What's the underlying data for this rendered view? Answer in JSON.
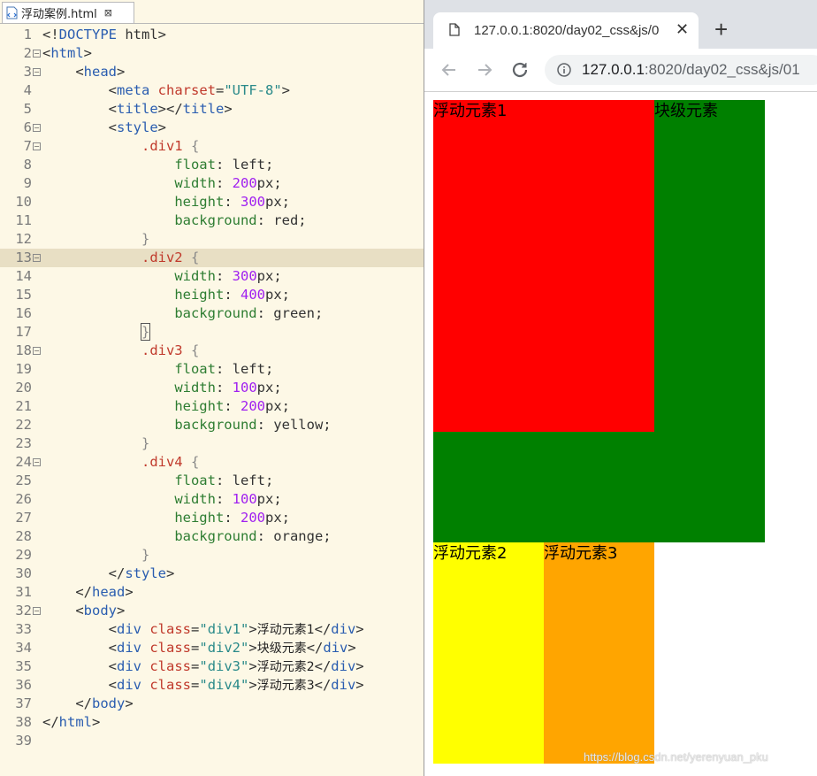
{
  "editor": {
    "tab_title": "浮动案例.html",
    "tab_close": "⊠",
    "highlighted_line": 13
  },
  "code_lines": [
    {
      "n": "1",
      "fold": false,
      "tokens": [
        [
          "t-punct",
          "<!"
        ],
        [
          "t-tag",
          "DOCTYPE"
        ],
        [
          "t-kw",
          " html"
        ],
        [
          "t-punct",
          ">"
        ]
      ]
    },
    {
      "n": "2",
      "fold": true,
      "tokens": [
        [
          "t-punct",
          "<"
        ],
        [
          "t-tag",
          "html"
        ],
        [
          "t-punct",
          ">"
        ]
      ]
    },
    {
      "n": "3",
      "fold": true,
      "tokens": [
        [
          "t-kw",
          "    "
        ],
        [
          "t-punct",
          "<"
        ],
        [
          "t-tag",
          "head"
        ],
        [
          "t-punct",
          ">"
        ]
      ]
    },
    {
      "n": "4",
      "fold": false,
      "tokens": [
        [
          "t-kw",
          "        "
        ],
        [
          "t-punct",
          "<"
        ],
        [
          "t-tag",
          "meta"
        ],
        [
          "t-kw",
          " "
        ],
        [
          "t-attr",
          "charset"
        ],
        [
          "t-punct",
          "="
        ],
        [
          "t-val",
          "\"UTF-8\""
        ],
        [
          "t-punct",
          ">"
        ]
      ]
    },
    {
      "n": "5",
      "fold": false,
      "tokens": [
        [
          "t-kw",
          "        "
        ],
        [
          "t-punct",
          "<"
        ],
        [
          "t-tag",
          "title"
        ],
        [
          "t-punct",
          "></"
        ],
        [
          "t-tag",
          "title"
        ],
        [
          "t-punct",
          ">"
        ]
      ]
    },
    {
      "n": "6",
      "fold": true,
      "tokens": [
        [
          "t-kw",
          "        "
        ],
        [
          "t-punct",
          "<"
        ],
        [
          "t-tag",
          "style"
        ],
        [
          "t-punct",
          ">"
        ]
      ]
    },
    {
      "n": "7",
      "fold": true,
      "tokens": [
        [
          "t-kw",
          "            "
        ],
        [
          "t-sel",
          ".div1"
        ],
        [
          "t-kw",
          " "
        ],
        [
          "t-brace",
          "{"
        ]
      ]
    },
    {
      "n": "8",
      "fold": false,
      "tokens": [
        [
          "t-kw",
          "                "
        ],
        [
          "t-prop",
          "float"
        ],
        [
          "t-kw",
          ": left;"
        ]
      ]
    },
    {
      "n": "9",
      "fold": false,
      "tokens": [
        [
          "t-kw",
          "                "
        ],
        [
          "t-prop",
          "width"
        ],
        [
          "t-kw",
          ": "
        ],
        [
          "t-num",
          "200"
        ],
        [
          "t-unit",
          "px;"
        ]
      ]
    },
    {
      "n": "10",
      "fold": false,
      "tokens": [
        [
          "t-kw",
          "                "
        ],
        [
          "t-prop",
          "height"
        ],
        [
          "t-kw",
          ": "
        ],
        [
          "t-num",
          "300"
        ],
        [
          "t-unit",
          "px;"
        ]
      ]
    },
    {
      "n": "11",
      "fold": false,
      "tokens": [
        [
          "t-kw",
          "                "
        ],
        [
          "t-prop",
          "background"
        ],
        [
          "t-kw",
          ": red;"
        ]
      ]
    },
    {
      "n": "12",
      "fold": false,
      "tokens": [
        [
          "t-kw",
          "            "
        ],
        [
          "t-brace",
          "}"
        ]
      ]
    },
    {
      "n": "13",
      "fold": true,
      "tokens": [
        [
          "t-kw",
          "            "
        ],
        [
          "t-sel",
          ".div2"
        ],
        [
          "t-kw",
          " "
        ],
        [
          "t-brace",
          "{"
        ]
      ]
    },
    {
      "n": "14",
      "fold": false,
      "tokens": [
        [
          "t-kw",
          "                "
        ],
        [
          "t-prop",
          "width"
        ],
        [
          "t-kw",
          ": "
        ],
        [
          "t-num",
          "300"
        ],
        [
          "t-unit",
          "px;"
        ]
      ]
    },
    {
      "n": "15",
      "fold": false,
      "tokens": [
        [
          "t-kw",
          "                "
        ],
        [
          "t-prop",
          "height"
        ],
        [
          "t-kw",
          ": "
        ],
        [
          "t-num",
          "400"
        ],
        [
          "t-unit",
          "px;"
        ]
      ]
    },
    {
      "n": "16",
      "fold": false,
      "tokens": [
        [
          "t-kw",
          "                "
        ],
        [
          "t-prop",
          "background"
        ],
        [
          "t-kw",
          ": green;"
        ]
      ]
    },
    {
      "n": "17",
      "fold": false,
      "tokens": [
        [
          "t-kw",
          "            "
        ],
        [
          "t-brace bracket-box",
          "}"
        ]
      ]
    },
    {
      "n": "18",
      "fold": true,
      "tokens": [
        [
          "t-kw",
          "            "
        ],
        [
          "t-sel",
          ".div3"
        ],
        [
          "t-kw",
          " "
        ],
        [
          "t-brace",
          "{"
        ]
      ]
    },
    {
      "n": "19",
      "fold": false,
      "tokens": [
        [
          "t-kw",
          "                "
        ],
        [
          "t-prop",
          "float"
        ],
        [
          "t-kw",
          ": left;"
        ]
      ]
    },
    {
      "n": "20",
      "fold": false,
      "tokens": [
        [
          "t-kw",
          "                "
        ],
        [
          "t-prop",
          "width"
        ],
        [
          "t-kw",
          ": "
        ],
        [
          "t-num",
          "100"
        ],
        [
          "t-unit",
          "px;"
        ]
      ]
    },
    {
      "n": "21",
      "fold": false,
      "tokens": [
        [
          "t-kw",
          "                "
        ],
        [
          "t-prop",
          "height"
        ],
        [
          "t-kw",
          ": "
        ],
        [
          "t-num",
          "200"
        ],
        [
          "t-unit",
          "px;"
        ]
      ]
    },
    {
      "n": "22",
      "fold": false,
      "tokens": [
        [
          "t-kw",
          "                "
        ],
        [
          "t-prop",
          "background"
        ],
        [
          "t-kw",
          ": yellow;"
        ]
      ]
    },
    {
      "n": "23",
      "fold": false,
      "tokens": [
        [
          "t-kw",
          "            "
        ],
        [
          "t-brace",
          "}"
        ]
      ]
    },
    {
      "n": "24",
      "fold": true,
      "tokens": [
        [
          "t-kw",
          "            "
        ],
        [
          "t-sel",
          ".div4"
        ],
        [
          "t-kw",
          " "
        ],
        [
          "t-brace",
          "{"
        ]
      ]
    },
    {
      "n": "25",
      "fold": false,
      "tokens": [
        [
          "t-kw",
          "                "
        ],
        [
          "t-prop",
          "float"
        ],
        [
          "t-kw",
          ": left;"
        ]
      ]
    },
    {
      "n": "26",
      "fold": false,
      "tokens": [
        [
          "t-kw",
          "                "
        ],
        [
          "t-prop",
          "width"
        ],
        [
          "t-kw",
          ": "
        ],
        [
          "t-num",
          "100"
        ],
        [
          "t-unit",
          "px;"
        ]
      ]
    },
    {
      "n": "27",
      "fold": false,
      "tokens": [
        [
          "t-kw",
          "                "
        ],
        [
          "t-prop",
          "height"
        ],
        [
          "t-kw",
          ": "
        ],
        [
          "t-num",
          "200"
        ],
        [
          "t-unit",
          "px;"
        ]
      ]
    },
    {
      "n": "28",
      "fold": false,
      "tokens": [
        [
          "t-kw",
          "                "
        ],
        [
          "t-prop",
          "background"
        ],
        [
          "t-kw",
          ": orange;"
        ]
      ]
    },
    {
      "n": "29",
      "fold": false,
      "tokens": [
        [
          "t-kw",
          "            "
        ],
        [
          "t-brace",
          "}"
        ]
      ]
    },
    {
      "n": "30",
      "fold": false,
      "tokens": [
        [
          "t-kw",
          "        "
        ],
        [
          "t-punct",
          "</"
        ],
        [
          "t-tag",
          "style"
        ],
        [
          "t-punct",
          ">"
        ]
      ]
    },
    {
      "n": "31",
      "fold": false,
      "tokens": [
        [
          "t-kw",
          "    "
        ],
        [
          "t-punct",
          "</"
        ],
        [
          "t-tag",
          "head"
        ],
        [
          "t-punct",
          ">"
        ]
      ]
    },
    {
      "n": "32",
      "fold": true,
      "tokens": [
        [
          "t-kw",
          "    "
        ],
        [
          "t-punct",
          "<"
        ],
        [
          "t-tag",
          "body"
        ],
        [
          "t-punct",
          ">"
        ]
      ]
    },
    {
      "n": "33",
      "fold": false,
      "tokens": [
        [
          "t-kw",
          "        "
        ],
        [
          "t-punct",
          "<"
        ],
        [
          "t-tag",
          "div"
        ],
        [
          "t-kw",
          " "
        ],
        [
          "t-attr",
          "class"
        ],
        [
          "t-punct",
          "="
        ],
        [
          "t-val",
          "\"div1\""
        ],
        [
          "t-punct",
          ">"
        ],
        [
          "t-cjk",
          "浮动元素1"
        ],
        [
          "t-punct",
          "</"
        ],
        [
          "t-tag",
          "div"
        ],
        [
          "t-punct",
          ">"
        ]
      ]
    },
    {
      "n": "34",
      "fold": false,
      "tokens": [
        [
          "t-kw",
          "        "
        ],
        [
          "t-punct",
          "<"
        ],
        [
          "t-tag",
          "div"
        ],
        [
          "t-kw",
          " "
        ],
        [
          "t-attr",
          "class"
        ],
        [
          "t-punct",
          "="
        ],
        [
          "t-val",
          "\"div2\""
        ],
        [
          "t-punct",
          ">"
        ],
        [
          "t-cjk",
          "块级元素"
        ],
        [
          "t-punct",
          "</"
        ],
        [
          "t-tag",
          "div"
        ],
        [
          "t-punct",
          ">"
        ]
      ]
    },
    {
      "n": "35",
      "fold": false,
      "tokens": [
        [
          "t-kw",
          "        "
        ],
        [
          "t-punct",
          "<"
        ],
        [
          "t-tag",
          "div"
        ],
        [
          "t-kw",
          " "
        ],
        [
          "t-attr",
          "class"
        ],
        [
          "t-punct",
          "="
        ],
        [
          "t-val",
          "\"div3\""
        ],
        [
          "t-punct",
          ">"
        ],
        [
          "t-cjk",
          "浮动元素2"
        ],
        [
          "t-punct",
          "</"
        ],
        [
          "t-tag",
          "div"
        ],
        [
          "t-punct",
          ">"
        ]
      ]
    },
    {
      "n": "36",
      "fold": false,
      "tokens": [
        [
          "t-kw",
          "        "
        ],
        [
          "t-punct",
          "<"
        ],
        [
          "t-tag",
          "div"
        ],
        [
          "t-kw",
          " "
        ],
        [
          "t-attr",
          "class"
        ],
        [
          "t-punct",
          "="
        ],
        [
          "t-val",
          "\"div4\""
        ],
        [
          "t-punct",
          ">"
        ],
        [
          "t-cjk",
          "浮动元素3"
        ],
        [
          "t-punct",
          "</"
        ],
        [
          "t-tag",
          "div"
        ],
        [
          "t-punct",
          ">"
        ]
      ]
    },
    {
      "n": "37",
      "fold": false,
      "tokens": [
        [
          "t-kw",
          "    "
        ],
        [
          "t-punct",
          "</"
        ],
        [
          "t-tag",
          "body"
        ],
        [
          "t-punct",
          ">"
        ]
      ]
    },
    {
      "n": "38",
      "fold": false,
      "tokens": [
        [
          "t-punct",
          "</"
        ],
        [
          "t-tag",
          "html"
        ],
        [
          "t-punct",
          ">"
        ]
      ]
    },
    {
      "n": "39",
      "fold": false,
      "tokens": []
    }
  ],
  "browser": {
    "tab_title": "127.0.0.1:8020/day02_css&js/0",
    "tab_close": "✕",
    "new_tab": "+",
    "url_host": "127.0.0.1",
    "url_rest": ":8020/day02_css&js/01",
    "colors": {
      "red": "#ff0000",
      "green": "#008000",
      "yellow": "#ffff00",
      "orange": "#ffa500"
    }
  },
  "page": {
    "div1_text": "浮动元素1",
    "div2_text": "块级元素",
    "div3_text": "浮动元素2",
    "div4_text": "浮动元素3"
  },
  "watermark": "https://blog.csdn.net/yerenyuan_pku"
}
